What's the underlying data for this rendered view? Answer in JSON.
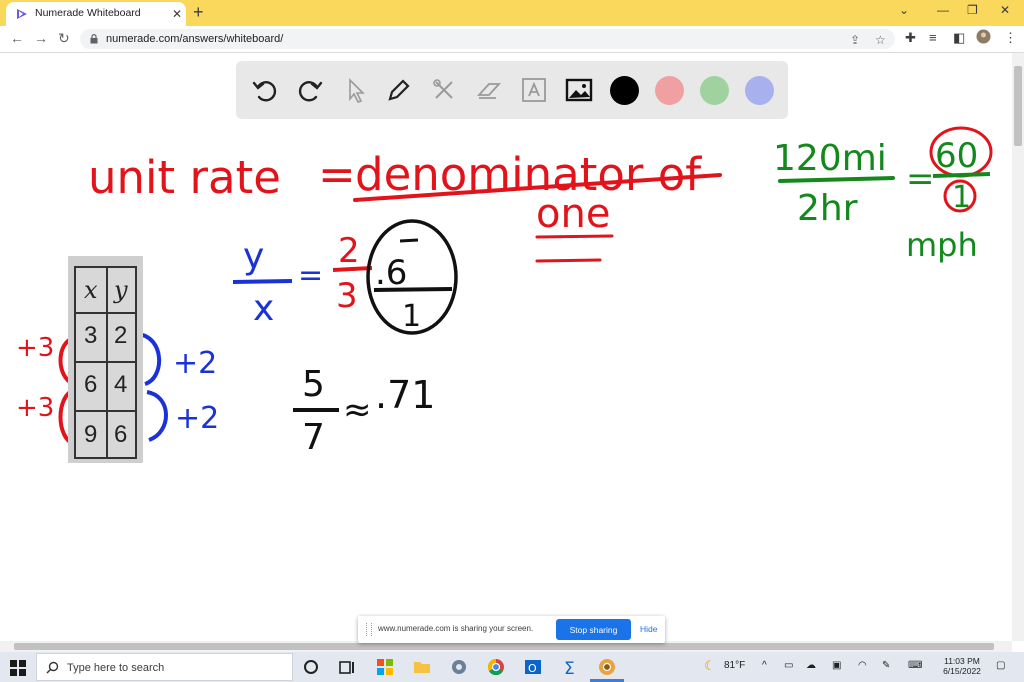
{
  "browser": {
    "tab_title": "Numerade Whiteboard",
    "url": "numerade.com/answers/whiteboard/"
  },
  "whiteboard": {
    "toolbar": {
      "tools": [
        "undo-icon",
        "redo-icon",
        "pointer-icon",
        "pen-icon",
        "tools-icon",
        "eraser-icon",
        "text-icon",
        "image-icon"
      ],
      "colors": [
        "#000000",
        "#f0a0a0",
        "#a0d2a0",
        "#a8b0ee"
      ]
    },
    "handwriting": {
      "unit_rate_line": [
        "unit rate",
        "=",
        "denominator of"
      ],
      "one": "one",
      "rate_numerator": "120mi",
      "rate_denominator": "2hr",
      "rate_equals": "=",
      "rate_result_num": "60",
      "rate_result_den": "1",
      "rate_unit": "mph",
      "ratio_y": "y",
      "ratio_x": "x",
      "ratio_equals": "=",
      "ratio_num": "2",
      "ratio_den": "3",
      "circled_num": ".6",
      "circled_den": "1",
      "frac_num": "5",
      "frac_den": "7",
      "approx": "≈",
      "approx_value": ".71",
      "left_step_1": "+3",
      "left_step_2": "+3",
      "right_step_1": "+2",
      "right_step_2": "+2"
    },
    "table": {
      "headers": [
        "x",
        "y"
      ],
      "rows": [
        [
          "3",
          "2"
        ],
        [
          "6",
          "4"
        ],
        [
          "9",
          "6"
        ]
      ]
    }
  },
  "share_banner": {
    "message": "www.numerade.com is sharing your screen.",
    "stop_label": "Stop sharing",
    "hide_label": "Hide"
  },
  "taskbar": {
    "search_placeholder": "Type here to search",
    "weather": "81°F",
    "time": "11:03 PM",
    "date": "6/15/2022"
  }
}
